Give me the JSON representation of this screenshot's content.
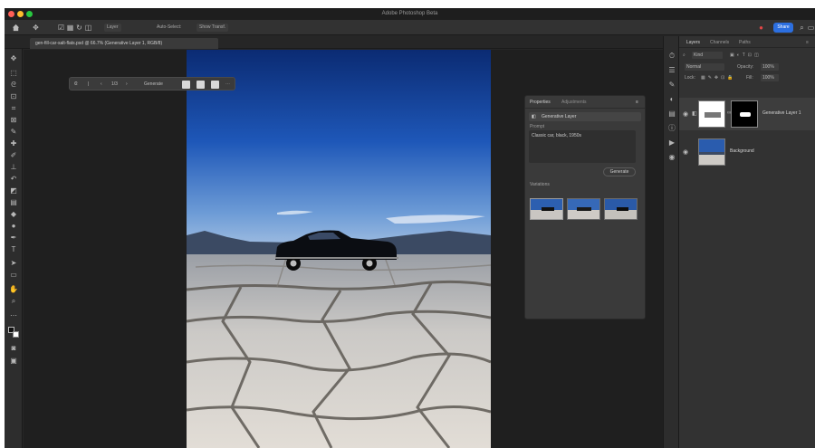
{
  "window": {
    "title": "Adobe Photoshop Beta"
  },
  "options_bar": {
    "auto_select_label": "Auto-Select:",
    "auto_select_value": "Layer",
    "transform_label": "Show Transf.",
    "share_label": "Share"
  },
  "document": {
    "tab_label": "gen-fill-car-salt-flats.psd @ 66.7% (Generative Layer 1, RGB/8)"
  },
  "contextual_task_bar": {
    "generate_label": "Generate"
  },
  "generative_panel": {
    "tabs": [
      "Properties",
      "Adjustments"
    ],
    "layer_label": "Generative Layer",
    "prompt_label": "Prompt",
    "prompt_text": "Classic car, black, 1950s",
    "generate_label": "Generate",
    "variations_label": "Variations"
  },
  "layers_panel": {
    "tabs": [
      "Layers",
      "Channels",
      "Paths"
    ],
    "kind_label": "Kind",
    "blend_mode": "Normal",
    "opacity_label": "Opacity:",
    "opacity_value": "100%",
    "lock_label": "Lock:",
    "fill_label": "Fill:",
    "fill_value": "100%",
    "layers": [
      {
        "name": "Generative Layer 1"
      },
      {
        "name": "Background"
      }
    ]
  },
  "colors": {
    "accent": "#2c6fe0",
    "panel": "#323232",
    "canvas": "#1f1f1f"
  }
}
